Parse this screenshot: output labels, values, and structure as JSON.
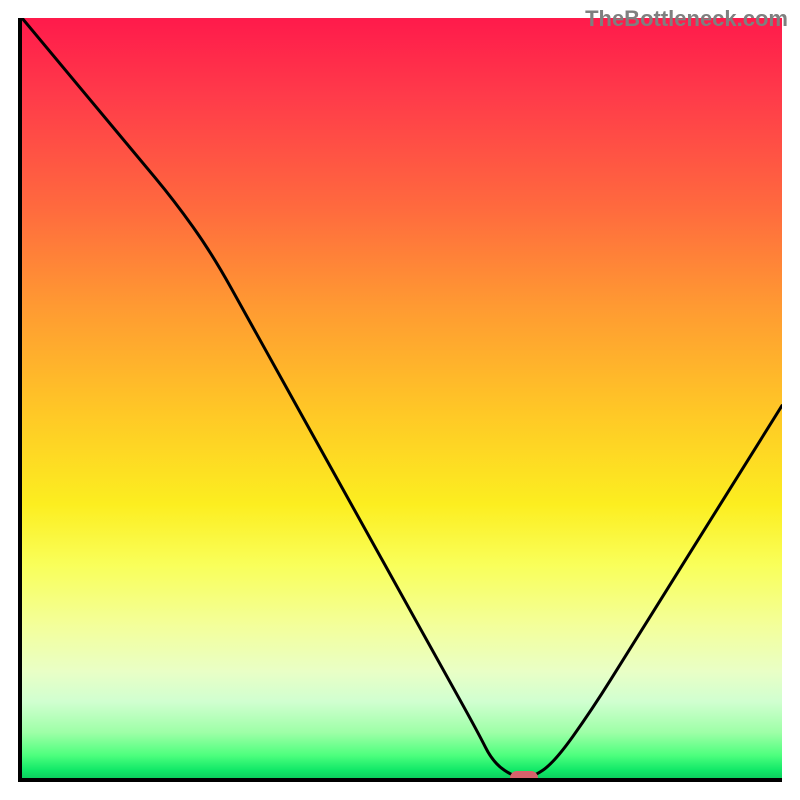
{
  "watermark": "TheBottleneck.com",
  "chart_data": {
    "type": "line",
    "title": "",
    "xlabel": "",
    "ylabel": "",
    "xlim": [
      0,
      100
    ],
    "ylim": [
      0,
      100
    ],
    "x": [
      0,
      5,
      10,
      15,
      20,
      25,
      30,
      35,
      40,
      45,
      50,
      55,
      60,
      62,
      65,
      67,
      70,
      75,
      80,
      85,
      90,
      95,
      100
    ],
    "y": [
      100,
      94,
      88,
      82,
      76,
      69,
      60,
      51,
      42,
      33,
      24,
      15,
      6,
      2,
      0,
      0,
      2,
      9,
      17,
      25,
      33,
      41,
      49
    ],
    "marker": {
      "x": 66,
      "y": 0
    },
    "grid": false,
    "legend": false,
    "colors": {
      "curve": "#000000",
      "marker": "#d6616b",
      "gradient_top": "#ff1a4b",
      "gradient_bottom": "#0cd05e"
    }
  }
}
